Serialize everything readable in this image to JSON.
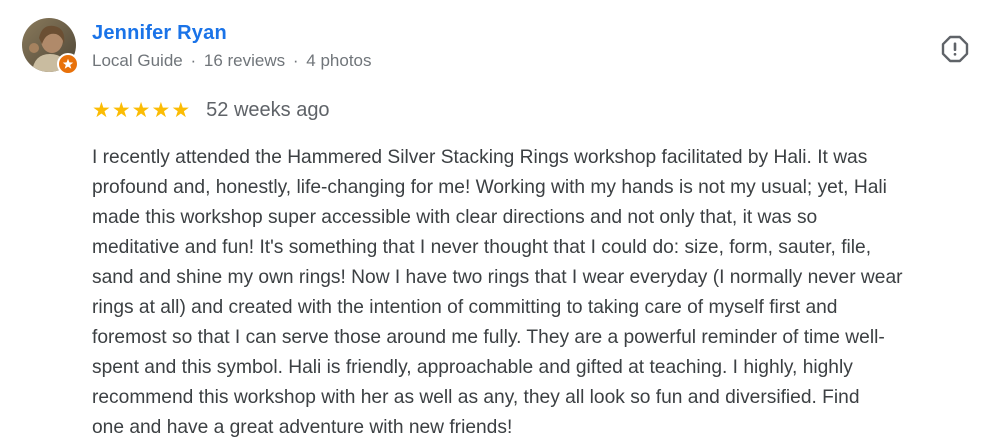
{
  "reviewer": {
    "name": "Jennifer Ryan",
    "badge": "Local Guide",
    "reviews_count": "16 reviews",
    "photos_count": "4 photos",
    "separator": "·"
  },
  "rating": {
    "stars": 5,
    "max_stars": 5,
    "star_glyph": "★",
    "star_color": "#fbbc04",
    "time_ago": "52 weeks ago"
  },
  "review_lines": [
    "I recently attended the Hammered Silver Stacking Rings workshop facilitated by Hali. It was",
    "profound and, honestly, life-changing for me! Working with my hands is not my usual; yet, Hali",
    "made this workshop super accessible with clear directions and not only that, it was so",
    "meditative and fun! It's something that I never thought that I could do: size, form, sauter, file,",
    "sand and shine my own rings! Now I have two rings that I wear everyday (I normally never wear",
    "rings at all) and created with the intention of committing to taking care of myself first and",
    "foremost so that I can serve those around me fully. They are a powerful reminder of time well-",
    "spent and this symbol. Hali is friendly, approachable and gifted at teaching. I highly, highly",
    "recommend this workshop with her as well as any, they all look so fun and diversified. Find",
    "one and have a great adventure with new friends!"
  ],
  "icons": {
    "flag": "report-flag-icon",
    "badge": "local-guide-badge-icon"
  },
  "colors": {
    "name_link": "#1a73e8",
    "meta_text": "#70757a",
    "badge_orange": "#e8710a"
  }
}
